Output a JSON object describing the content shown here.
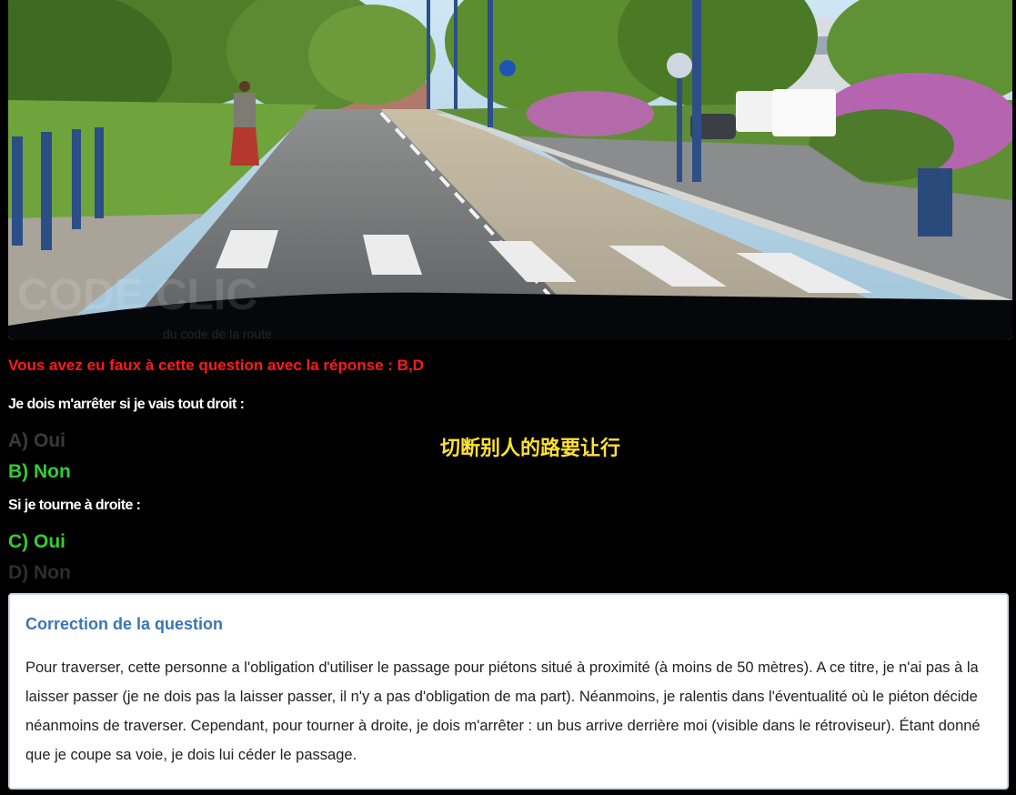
{
  "question_image": {
    "icon": "road-scene-photo",
    "watermark": {
      "brand": "CODE CLIC",
      "tagline": "du code de la route"
    }
  },
  "feedback": "Vous avez eu faux à cette question avec la réponse : B,D",
  "questions": [
    {
      "label": "Je dois m'arrêter si je vais tout droit :",
      "answers": [
        {
          "text": "A) Oui",
          "state": "inactive",
          "color": "#3a3a3a"
        },
        {
          "text": "B) Non",
          "state": "correct",
          "color": "#33cc33"
        }
      ]
    },
    {
      "label": "Si je tourne à droite :",
      "answers": [
        {
          "text": "C) Oui",
          "state": "correct",
          "color": "#33cc33"
        },
        {
          "text": "D) Non",
          "state": "inactive",
          "color": "#2e2e2e"
        }
      ]
    }
  ],
  "overlay_note": "切断别人的路要让行",
  "correction": {
    "title": "Correction de la question",
    "text": "Pour traverser, cette personne a l'obligation d'utiliser le passage pour piétons situé à proximité (à moins de 50 mètres). A ce titre, je n'ai pas à la laisser passer (je ne dois pas la laisser passer, il n'y a pas d'obligation de ma part). Néanmoins, je ralentis dans l'éventualité où le piéton décide néanmoins de traverser. Cependant, pour tourner à droite, je dois m'arrêter : un bus arrive derrière moi (visible dans le rétroviseur). Étant donné que je coupe sa voie, je dois lui céder le passage."
  },
  "colors": {
    "background": "#000000",
    "error": "#ff1a1a",
    "correct": "#33cc33",
    "correction_title": "#3a75b8",
    "overlay": "#ffe22e"
  }
}
